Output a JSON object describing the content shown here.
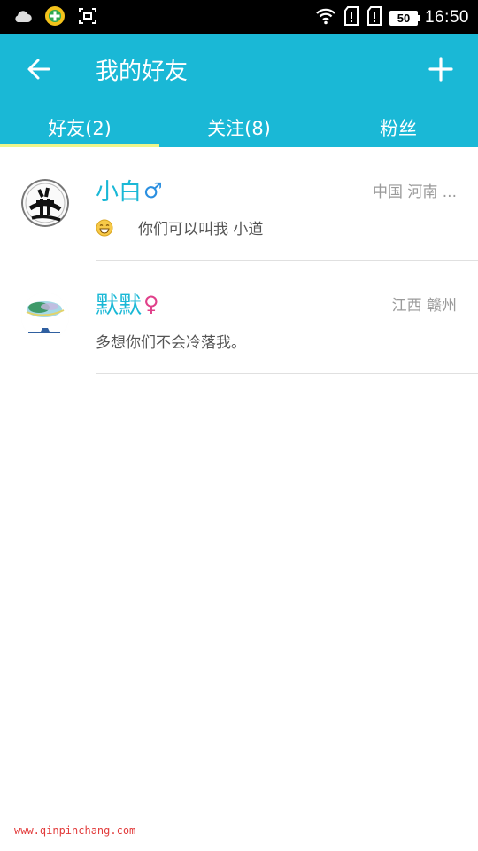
{
  "status_bar": {
    "time": "16:50",
    "battery": "50",
    "icons": [
      "cloud-icon",
      "app-badge-icon",
      "screenshot-icon",
      "wifi-icon",
      "sim-icon",
      "sim-icon"
    ]
  },
  "app_bar": {
    "title": "我的好友",
    "back_icon": "arrow-left-icon",
    "add_icon": "plus-icon",
    "background": "#1ab8d6"
  },
  "tabs": [
    {
      "label": "好友(2)",
      "active": true
    },
    {
      "label": "关注(8)",
      "active": false
    },
    {
      "label": "粉丝",
      "active": false
    }
  ],
  "friends": [
    {
      "name": "小白",
      "gender_symbol": "♂",
      "gender": "male",
      "location": "中国 河南 ...",
      "message": "你们可以叫我  小道",
      "has_emoji": true
    },
    {
      "name": "默默",
      "gender_symbol": "♀",
      "gender": "female",
      "location": "江西 赣州",
      "message": "多想你们不会冷落我。",
      "has_emoji": false
    }
  ],
  "watermark": "www.qinpinchang.com"
}
